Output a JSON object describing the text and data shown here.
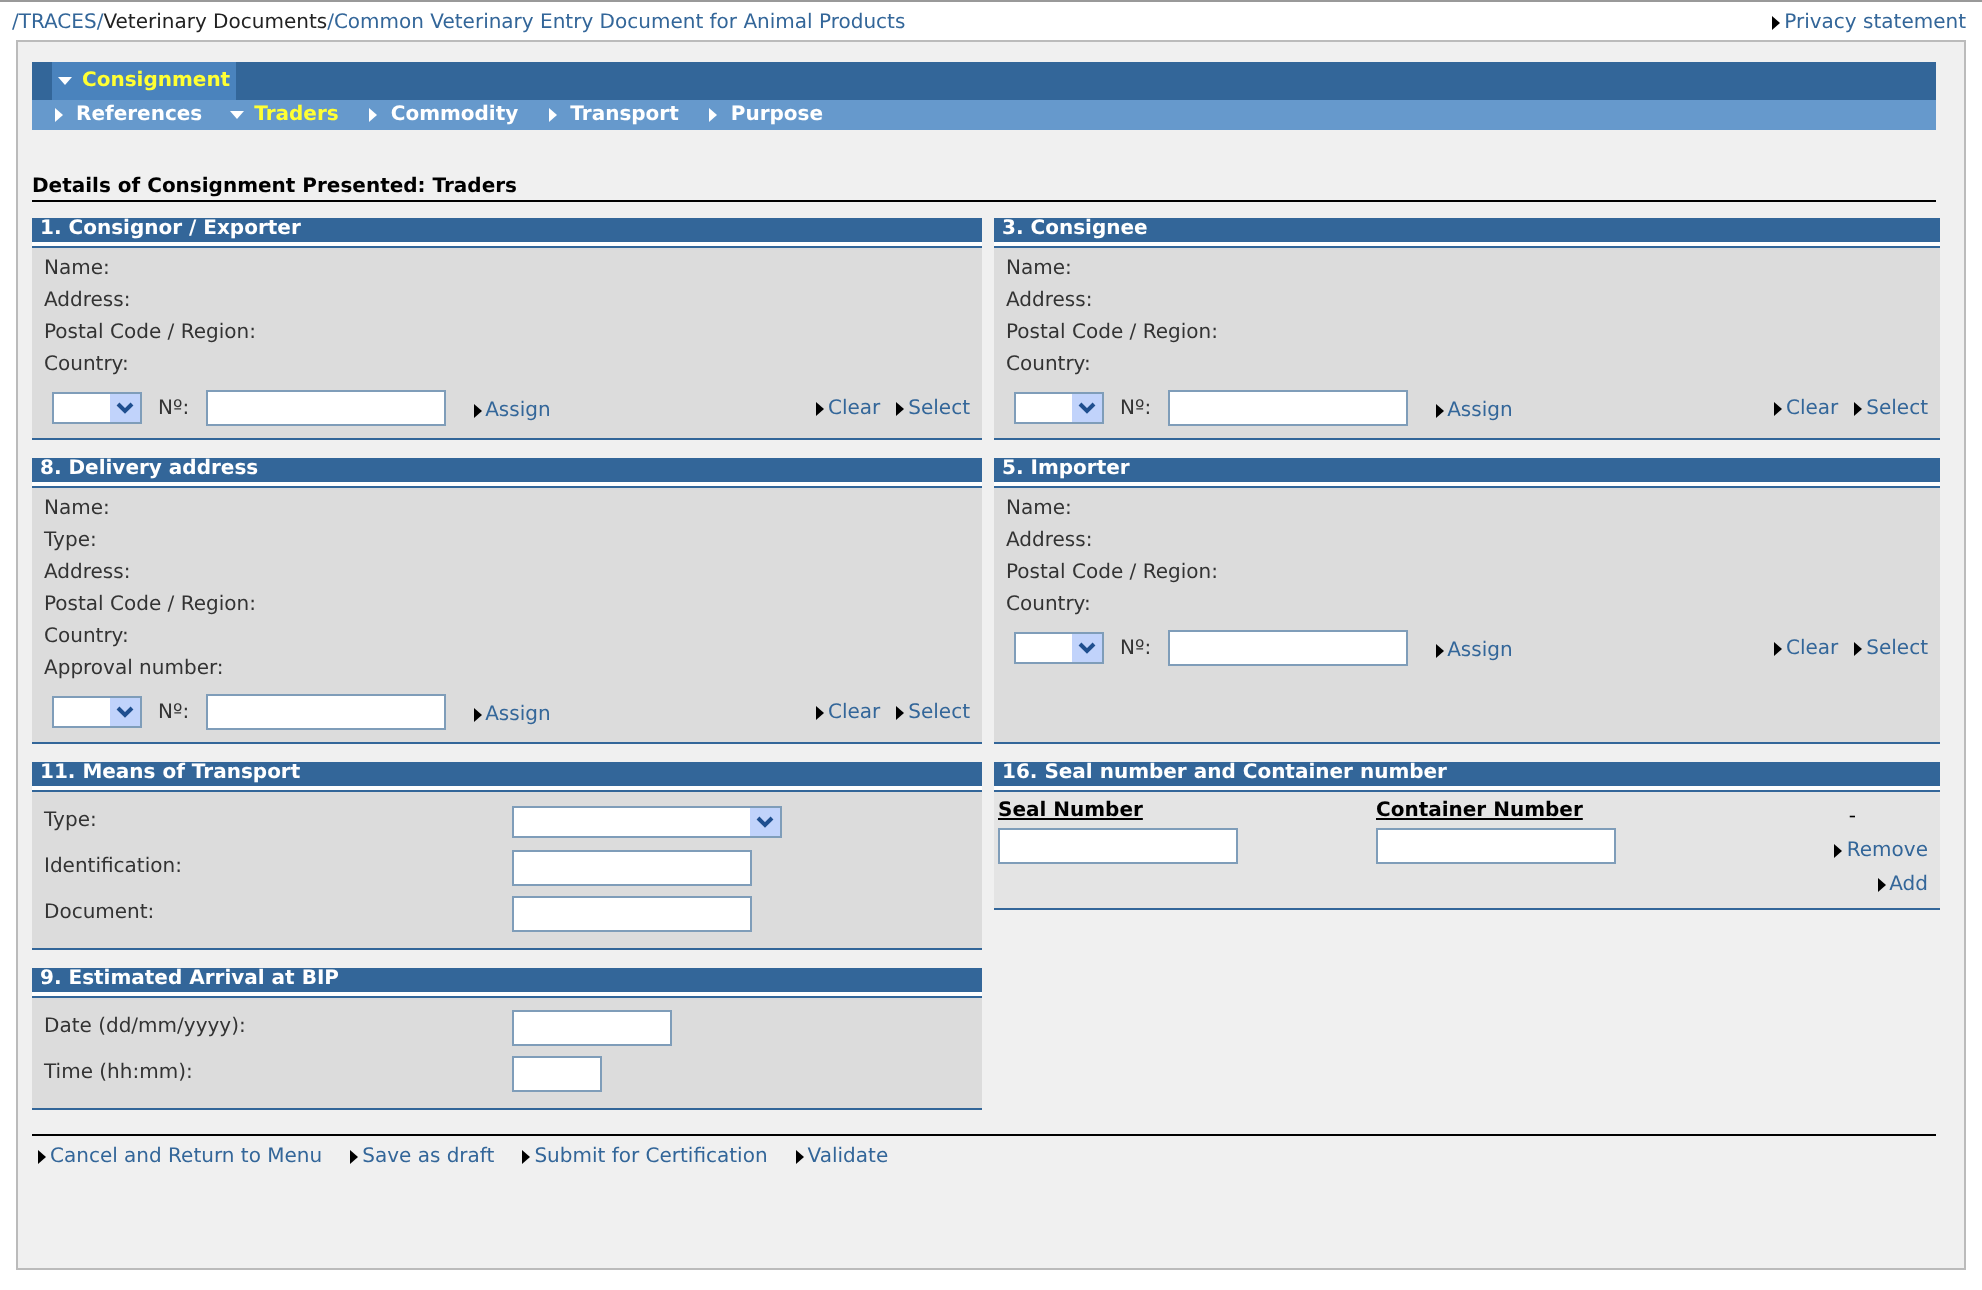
{
  "breadcrumb": [
    {
      "text": "/TRACES/",
      "kind": "link"
    },
    {
      "text": "Veterinary Documents",
      "kind": "plain"
    },
    {
      "text": "/Common Veterinary Entry Document for Animal Products",
      "kind": "link"
    }
  ],
  "privacy_link": "Privacy statement",
  "nav": {
    "main_tabs": [
      {
        "label": "Consignment",
        "selected": true
      }
    ],
    "sub_tabs": [
      {
        "label": "References",
        "selected": false
      },
      {
        "label": "Traders",
        "selected": true
      },
      {
        "label": "Commodity",
        "selected": false
      },
      {
        "label": "Transport",
        "selected": false
      },
      {
        "label": "Purpose",
        "selected": false
      }
    ]
  },
  "heading": "Details of Consignment Presented: Traders",
  "section_rows": [
    [
      {
        "kind": "trader",
        "title": "1. Consignor / Exporter",
        "fields": [
          "Name:",
          "Address:",
          "Postal Code / Region:",
          "Country:"
        ],
        "number_label": "Nº:",
        "assign": "Assign",
        "clear": "Clear",
        "select": "Select"
      },
      {
        "kind": "trader",
        "title": "3. Consignee",
        "fields": [
          "Name:",
          "Address:",
          "Postal Code / Region:",
          "Country:"
        ],
        "number_label": "Nº:",
        "assign": "Assign",
        "clear": "Clear",
        "select": "Select"
      }
    ],
    [
      {
        "kind": "trader",
        "title": "8. Delivery address",
        "fields": [
          "Name:",
          "Type:",
          "Address:",
          "Postal Code / Region:",
          "Country:",
          "Approval number:"
        ],
        "number_label": "Nº:",
        "assign": "Assign",
        "clear": "Clear",
        "select": "Select"
      },
      {
        "kind": "trader",
        "title": "5. Importer",
        "fields": [
          "Name:",
          "Address:",
          "Postal Code / Region:",
          "Country:"
        ],
        "number_label": "Nº:",
        "assign": "Assign",
        "clear": "Clear",
        "select": "Select"
      }
    ],
    [
      {
        "kind": "form",
        "title": "11. Means of Transport",
        "rows": [
          {
            "label": "Type:",
            "kind": "select"
          },
          {
            "label": "Identification:",
            "kind": "input"
          },
          {
            "label": "Document:",
            "kind": "input"
          }
        ]
      },
      {
        "kind": "seal",
        "title": "16. Seal number and Container number",
        "columns": [
          "Seal Number",
          "Container Number"
        ],
        "dash": "-",
        "remove": "Remove",
        "add": "Add"
      }
    ],
    [
      {
        "kind": "form",
        "title": "9. Estimated Arrival at BIP",
        "rows": [
          {
            "label": "Date (dd/mm/yyyy):",
            "kind": "date"
          },
          {
            "label": "Time (hh:mm):",
            "kind": "time"
          }
        ]
      }
    ]
  ],
  "footer_links": [
    "Cancel and Return to Menu",
    "Save as draft",
    "Submit for Certification",
    "Validate"
  ]
}
